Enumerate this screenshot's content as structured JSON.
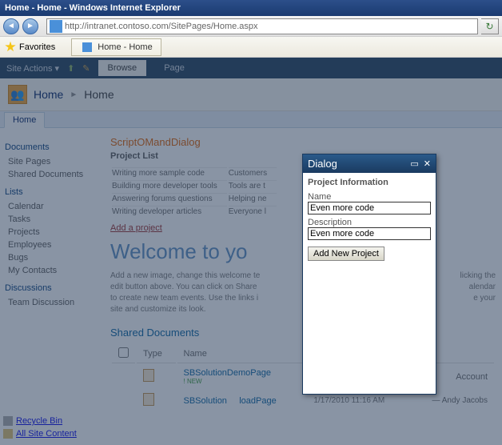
{
  "window": {
    "title": "Home - Home - Windows Internet Explorer"
  },
  "url": {
    "value": "http://intranet.contoso.com/SitePages/Home.aspx"
  },
  "favorites": {
    "label": "Favorites"
  },
  "tab": {
    "label": "Home - Home"
  },
  "ribbon": {
    "site_actions": "Site Actions",
    "browse": "Browse",
    "page": "Page"
  },
  "breadcrumb": {
    "root": "Home",
    "arrow": "►",
    "current": "Home"
  },
  "topnav": {
    "home": "Home"
  },
  "leftnav": {
    "h1": "Documents",
    "a1": "Site Pages",
    "a2": "Shared Documents",
    "h2": "Lists",
    "b1": "Calendar",
    "b2": "Tasks",
    "b3": "Projects",
    "b4": "Employees",
    "b5": "Bugs",
    "b6": "My Contacts",
    "h3": "Discussions",
    "c1": "Team Discussion"
  },
  "footer": {
    "recycle": "Recycle Bin",
    "allcontent": "All Site Content"
  },
  "main": {
    "webpart_title": "ScriptOMandDialog",
    "list_title": "Project List",
    "projects": {
      "r0c0": "Writing more sample code",
      "r0c1": "Customers",
      "r1c0": "Building more developer tools",
      "r1c1": "Tools are t",
      "r2c0": "Answering forums questions",
      "r2c1": "Helping ne",
      "r3c0": "Writing developer articles",
      "r3c1": "Everyone l"
    },
    "add_project": "Add a project",
    "welcome": "Welcome to yo",
    "body_text": "Add a new image, change this welcome te\nedit button above. You can click on Share\nto create new team events. Use the links i\nsite and customize its look.",
    "body_right1": "licking the",
    "body_right2": "alendar",
    "body_right3": "e your",
    "shared_docs": "Shared Documents",
    "cols": {
      "type": "Type",
      "name": "Name"
    },
    "doc1": "SBSolutionDemoPage",
    "doc1_new": "! NEW",
    "doc2_a": "SBSolution",
    "doc2_b": "loadPage",
    "doc2_date": "1/17/2010 11:16 AM",
    "author1": "Account",
    "author2": "— Andy Jacobs"
  },
  "dialog": {
    "title": "Dialog",
    "section": "Project Information",
    "name_label": "Name",
    "name_value": "Even more code",
    "desc_label": "Description",
    "desc_value": "Even more code",
    "button": "Add New Project"
  }
}
